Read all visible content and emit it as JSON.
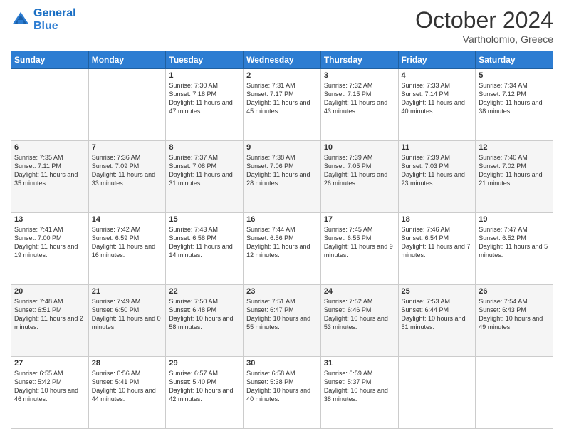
{
  "header": {
    "logo_line1": "General",
    "logo_line2": "Blue",
    "month_title": "October 2024",
    "location": "Vartholomio, Greece"
  },
  "days_of_week": [
    "Sunday",
    "Monday",
    "Tuesday",
    "Wednesday",
    "Thursday",
    "Friday",
    "Saturday"
  ],
  "weeks": [
    [
      {
        "num": "",
        "sunrise": "",
        "sunset": "",
        "daylight": ""
      },
      {
        "num": "",
        "sunrise": "",
        "sunset": "",
        "daylight": ""
      },
      {
        "num": "1",
        "sunrise": "Sunrise: 7:30 AM",
        "sunset": "Sunset: 7:18 PM",
        "daylight": "Daylight: 11 hours and 47 minutes."
      },
      {
        "num": "2",
        "sunrise": "Sunrise: 7:31 AM",
        "sunset": "Sunset: 7:17 PM",
        "daylight": "Daylight: 11 hours and 45 minutes."
      },
      {
        "num": "3",
        "sunrise": "Sunrise: 7:32 AM",
        "sunset": "Sunset: 7:15 PM",
        "daylight": "Daylight: 11 hours and 43 minutes."
      },
      {
        "num": "4",
        "sunrise": "Sunrise: 7:33 AM",
        "sunset": "Sunset: 7:14 PM",
        "daylight": "Daylight: 11 hours and 40 minutes."
      },
      {
        "num": "5",
        "sunrise": "Sunrise: 7:34 AM",
        "sunset": "Sunset: 7:12 PM",
        "daylight": "Daylight: 11 hours and 38 minutes."
      }
    ],
    [
      {
        "num": "6",
        "sunrise": "Sunrise: 7:35 AM",
        "sunset": "Sunset: 7:11 PM",
        "daylight": "Daylight: 11 hours and 35 minutes."
      },
      {
        "num": "7",
        "sunrise": "Sunrise: 7:36 AM",
        "sunset": "Sunset: 7:09 PM",
        "daylight": "Daylight: 11 hours and 33 minutes."
      },
      {
        "num": "8",
        "sunrise": "Sunrise: 7:37 AM",
        "sunset": "Sunset: 7:08 PM",
        "daylight": "Daylight: 11 hours and 31 minutes."
      },
      {
        "num": "9",
        "sunrise": "Sunrise: 7:38 AM",
        "sunset": "Sunset: 7:06 PM",
        "daylight": "Daylight: 11 hours and 28 minutes."
      },
      {
        "num": "10",
        "sunrise": "Sunrise: 7:39 AM",
        "sunset": "Sunset: 7:05 PM",
        "daylight": "Daylight: 11 hours and 26 minutes."
      },
      {
        "num": "11",
        "sunrise": "Sunrise: 7:39 AM",
        "sunset": "Sunset: 7:03 PM",
        "daylight": "Daylight: 11 hours and 23 minutes."
      },
      {
        "num": "12",
        "sunrise": "Sunrise: 7:40 AM",
        "sunset": "Sunset: 7:02 PM",
        "daylight": "Daylight: 11 hours and 21 minutes."
      }
    ],
    [
      {
        "num": "13",
        "sunrise": "Sunrise: 7:41 AM",
        "sunset": "Sunset: 7:00 PM",
        "daylight": "Daylight: 11 hours and 19 minutes."
      },
      {
        "num": "14",
        "sunrise": "Sunrise: 7:42 AM",
        "sunset": "Sunset: 6:59 PM",
        "daylight": "Daylight: 11 hours and 16 minutes."
      },
      {
        "num": "15",
        "sunrise": "Sunrise: 7:43 AM",
        "sunset": "Sunset: 6:58 PM",
        "daylight": "Daylight: 11 hours and 14 minutes."
      },
      {
        "num": "16",
        "sunrise": "Sunrise: 7:44 AM",
        "sunset": "Sunset: 6:56 PM",
        "daylight": "Daylight: 11 hours and 12 minutes."
      },
      {
        "num": "17",
        "sunrise": "Sunrise: 7:45 AM",
        "sunset": "Sunset: 6:55 PM",
        "daylight": "Daylight: 11 hours and 9 minutes."
      },
      {
        "num": "18",
        "sunrise": "Sunrise: 7:46 AM",
        "sunset": "Sunset: 6:54 PM",
        "daylight": "Daylight: 11 hours and 7 minutes."
      },
      {
        "num": "19",
        "sunrise": "Sunrise: 7:47 AM",
        "sunset": "Sunset: 6:52 PM",
        "daylight": "Daylight: 11 hours and 5 minutes."
      }
    ],
    [
      {
        "num": "20",
        "sunrise": "Sunrise: 7:48 AM",
        "sunset": "Sunset: 6:51 PM",
        "daylight": "Daylight: 11 hours and 2 minutes."
      },
      {
        "num": "21",
        "sunrise": "Sunrise: 7:49 AM",
        "sunset": "Sunset: 6:50 PM",
        "daylight": "Daylight: 11 hours and 0 minutes."
      },
      {
        "num": "22",
        "sunrise": "Sunrise: 7:50 AM",
        "sunset": "Sunset: 6:48 PM",
        "daylight": "Daylight: 10 hours and 58 minutes."
      },
      {
        "num": "23",
        "sunrise": "Sunrise: 7:51 AM",
        "sunset": "Sunset: 6:47 PM",
        "daylight": "Daylight: 10 hours and 55 minutes."
      },
      {
        "num": "24",
        "sunrise": "Sunrise: 7:52 AM",
        "sunset": "Sunset: 6:46 PM",
        "daylight": "Daylight: 10 hours and 53 minutes."
      },
      {
        "num": "25",
        "sunrise": "Sunrise: 7:53 AM",
        "sunset": "Sunset: 6:44 PM",
        "daylight": "Daylight: 10 hours and 51 minutes."
      },
      {
        "num": "26",
        "sunrise": "Sunrise: 7:54 AM",
        "sunset": "Sunset: 6:43 PM",
        "daylight": "Daylight: 10 hours and 49 minutes."
      }
    ],
    [
      {
        "num": "27",
        "sunrise": "Sunrise: 6:55 AM",
        "sunset": "Sunset: 5:42 PM",
        "daylight": "Daylight: 10 hours and 46 minutes."
      },
      {
        "num": "28",
        "sunrise": "Sunrise: 6:56 AM",
        "sunset": "Sunset: 5:41 PM",
        "daylight": "Daylight: 10 hours and 44 minutes."
      },
      {
        "num": "29",
        "sunrise": "Sunrise: 6:57 AM",
        "sunset": "Sunset: 5:40 PM",
        "daylight": "Daylight: 10 hours and 42 minutes."
      },
      {
        "num": "30",
        "sunrise": "Sunrise: 6:58 AM",
        "sunset": "Sunset: 5:38 PM",
        "daylight": "Daylight: 10 hours and 40 minutes."
      },
      {
        "num": "31",
        "sunrise": "Sunrise: 6:59 AM",
        "sunset": "Sunset: 5:37 PM",
        "daylight": "Daylight: 10 hours and 38 minutes."
      },
      {
        "num": "",
        "sunrise": "",
        "sunset": "",
        "daylight": ""
      },
      {
        "num": "",
        "sunrise": "",
        "sunset": "",
        "daylight": ""
      }
    ]
  ]
}
